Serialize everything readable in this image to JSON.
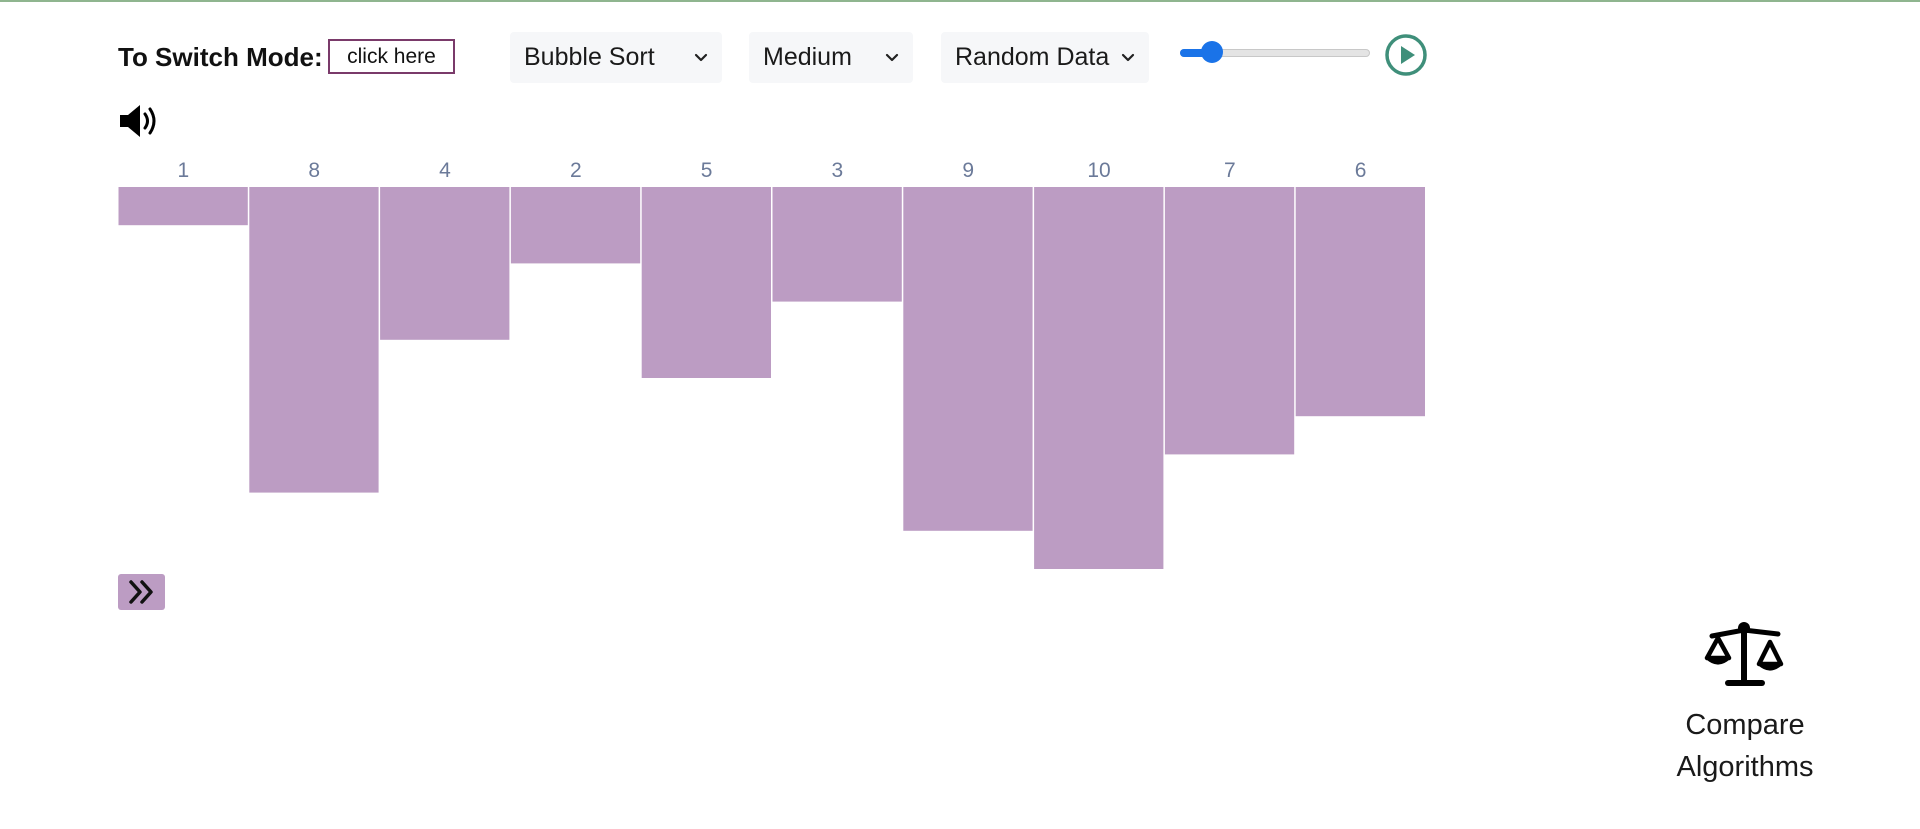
{
  "controls": {
    "switch_mode_label": "To Switch Mode:",
    "switch_mode_button": "click here",
    "algorithm": "Bubble Sort",
    "speed": "Medium",
    "data_type": "Random Data",
    "speed_slider_value": 0.17
  },
  "icons": {
    "sound": "speaker-volume-icon",
    "play": "play-circle-icon",
    "step": "double-chevron-right-icon",
    "compare": "balance-scale-icon"
  },
  "chart_data": {
    "type": "bar",
    "categories": [
      "1",
      "8",
      "4",
      "2",
      "5",
      "3",
      "9",
      "10",
      "7",
      "6"
    ],
    "values": [
      1,
      8,
      4,
      2,
      5,
      3,
      9,
      10,
      7,
      6
    ],
    "ylim": [
      0,
      10
    ],
    "bar_color": "#bc9cc3",
    "label_color": "#6b7a99",
    "orientation": "downward"
  },
  "compare": {
    "label": "Compare Algorithms"
  }
}
